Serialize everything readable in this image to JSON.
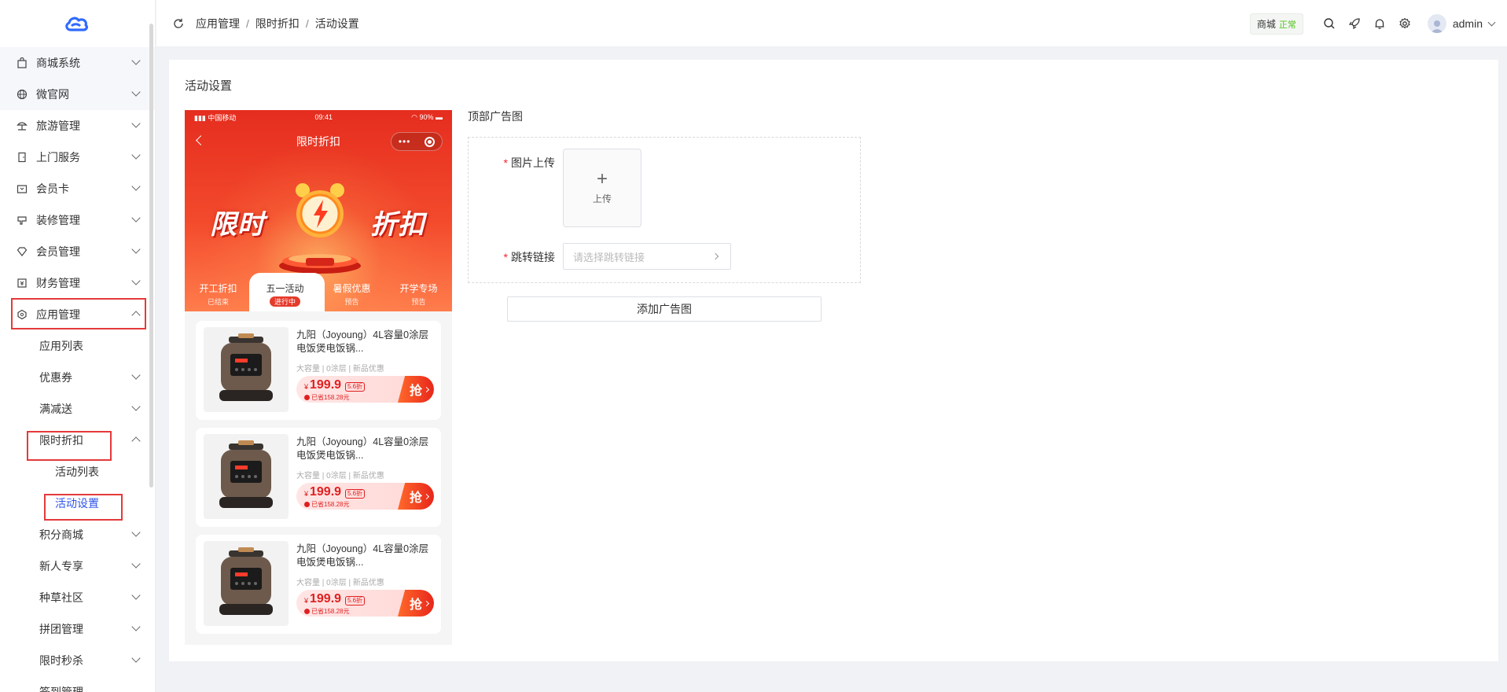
{
  "sidebar": {
    "items": [
      {
        "label": "商城系统",
        "icon": "bag-icon",
        "expanded": false
      },
      {
        "label": "微官网",
        "icon": "globe-icon",
        "expanded": false
      },
      {
        "label": "旅游管理",
        "icon": "umbrella-icon",
        "expanded": false
      },
      {
        "label": "上门服务",
        "icon": "door-icon",
        "expanded": false
      },
      {
        "label": "会员卡",
        "icon": "card-icon",
        "expanded": false
      },
      {
        "label": "装修管理",
        "icon": "decorate-icon",
        "expanded": false
      },
      {
        "label": "会员管理",
        "icon": "diamond-icon",
        "expanded": false
      },
      {
        "label": "财务管理",
        "icon": "finance-icon",
        "expanded": false
      },
      {
        "label": "应用管理",
        "icon": "app-icon",
        "expanded": true
      }
    ],
    "sub_items": [
      {
        "label": "应用列表"
      },
      {
        "label": "优惠券",
        "expandable": true
      },
      {
        "label": "满减送",
        "expandable": true
      },
      {
        "label": "限时折扣",
        "expandable": true,
        "expanded": true
      }
    ],
    "sub_sub_items": [
      {
        "label": "活动列表"
      },
      {
        "label": "活动设置",
        "active": true
      }
    ],
    "more_items": [
      {
        "label": "积分商城"
      },
      {
        "label": "新人专享"
      },
      {
        "label": "种草社区"
      },
      {
        "label": "拼团管理"
      },
      {
        "label": "限时秒杀"
      },
      {
        "label": "签到管理"
      }
    ]
  },
  "header": {
    "breadcrumb": [
      "应用管理",
      "限时折扣",
      "活动设置"
    ],
    "separator": "/",
    "shop_badge": "商城",
    "shop_status": "正常",
    "username": "admin"
  },
  "main": {
    "title": "活动设置"
  },
  "preview": {
    "status_carrier": "中国移动",
    "status_time": "09:41",
    "status_battery": "90%",
    "nav_title": "限时折扣",
    "banner_left": "限时",
    "banner_right": "折扣",
    "tabs": [
      {
        "label": "开工折扣",
        "sub": "已结束"
      },
      {
        "label": "五一活动",
        "sub": "进行中",
        "active": true
      },
      {
        "label": "暑假优惠",
        "sub": "预告"
      },
      {
        "label": "开学专场",
        "sub": "预告"
      }
    ],
    "products": [
      {
        "name": "九阳（Joyoung）4L容量0涂层电饭煲电饭锅...",
        "tags": "大容量 | 0涂层 | 新品优惠",
        "currency": "¥",
        "price": "199.9",
        "discount": "5.6折",
        "save": "已省158.28元",
        "button": "抢"
      },
      {
        "name": "九阳（Joyoung）4L容量0涂层电饭煲电饭锅...",
        "tags": "大容量 | 0涂层 | 新品优惠",
        "currency": "¥",
        "price": "199.9",
        "discount": "5.6折",
        "save": "已省158.28元",
        "button": "抢"
      },
      {
        "name": "九阳（Joyoung）4L容量0涂层电饭煲电饭锅...",
        "tags": "大容量 | 0涂层 | 新品优惠",
        "currency": "¥",
        "price": "199.9",
        "discount": "5.6折",
        "save": "已省158.28元",
        "button": "抢"
      }
    ]
  },
  "form": {
    "section_title": "顶部广告图",
    "image_label": "图片上传",
    "upload_text": "上传",
    "link_label": "跳转链接",
    "link_placeholder": "请选择跳转链接",
    "add_button": "添加广告图"
  },
  "colors": {
    "accent": "#2f54eb",
    "highlight_box": "#e5393a",
    "banner_red": "#e52d1f",
    "price_red": "#e02020",
    "status_green": "#52c41a"
  }
}
